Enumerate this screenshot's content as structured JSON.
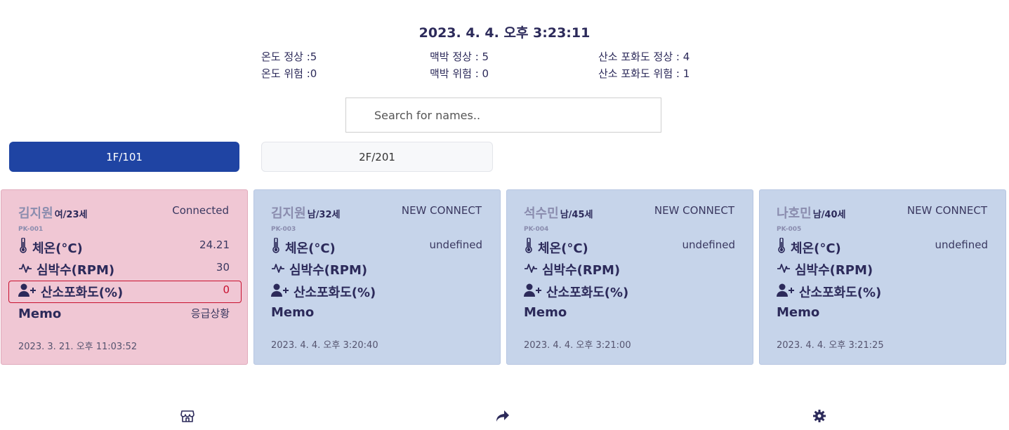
{
  "header": {
    "datetime": "2023. 4. 4. 오후 3:23:11",
    "stats": {
      "temp_normal": "온도 정상 :5",
      "temp_danger": "온도 위험 :0",
      "pulse_normal": "맥박 정상 : 5",
      "pulse_danger": "맥박 위험 : 0",
      "spo2_normal": "산소 포화도 정상 : 4",
      "spo2_danger": "산소 포화도 위험 : 1"
    }
  },
  "search": {
    "placeholder": "Search for names.."
  },
  "tabs": [
    {
      "label": "1F/101",
      "active": true
    },
    {
      "label": "2F/201",
      "active": false
    }
  ],
  "labels": {
    "temp": "체온(°C)",
    "pulse": "심박수(RPM)",
    "spo2": "산소포화도(%)",
    "memo": "Memo"
  },
  "cards": [
    {
      "name": "김지원",
      "info": "여/23세",
      "status": "Connected",
      "id": "PK-001",
      "temp": "24.21",
      "pulse": "30",
      "spo2": "0",
      "memo": "응급상황",
      "timestamp": "2023. 3. 21. 오후 11:03:52",
      "alert": true
    },
    {
      "name": "김지원",
      "info": "남/32세",
      "status": "NEW CONNECT",
      "id": "PK-003",
      "temp": "undefined",
      "pulse": "",
      "spo2": "",
      "memo": "",
      "timestamp": "2023. 4. 4. 오후 3:20:40",
      "alert": false
    },
    {
      "name": "석수민",
      "info": "남/45세",
      "status": "NEW CONNECT",
      "id": "PK-004",
      "temp": "undefined",
      "pulse": "",
      "spo2": "",
      "memo": "",
      "timestamp": "2023. 4. 4. 오후 3:21:00",
      "alert": false
    },
    {
      "name": "나호민",
      "info": "남/40세",
      "status": "NEW CONNECT",
      "id": "PK-005",
      "temp": "undefined",
      "pulse": "",
      "spo2": "",
      "memo": "",
      "timestamp": "2023. 4. 4. 오후 3:21:25",
      "alert": false
    }
  ],
  "colors": {
    "accent": "#1f44a3",
    "card_normal": "#c6d4ea",
    "card_alert": "#f0c7d4",
    "danger": "#c8102e",
    "text": "#2c2a5a"
  },
  "nav": [
    "store-icon",
    "share-icon",
    "gear-icon"
  ]
}
